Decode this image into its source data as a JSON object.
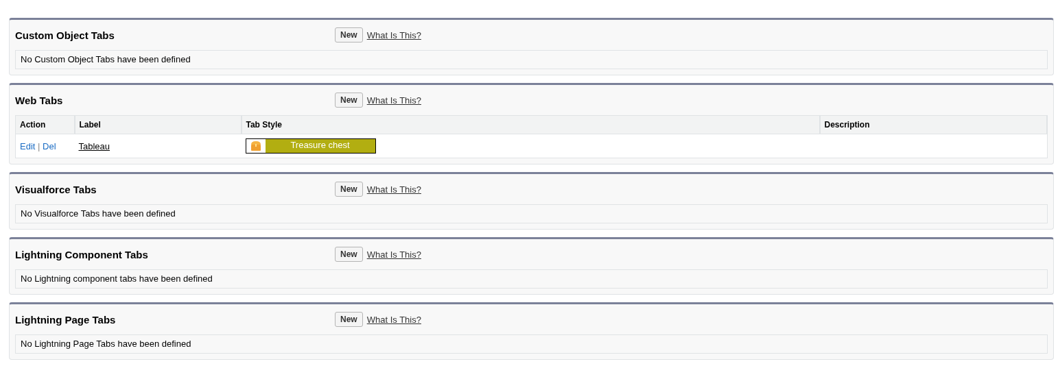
{
  "sections": [
    {
      "title": "Custom Object Tabs",
      "kind": "empty",
      "new_button": "New",
      "help_link": "What Is This?",
      "message": "No Custom Object Tabs have been defined"
    },
    {
      "title": "Web Tabs",
      "kind": "table",
      "new_button": "New",
      "help_link": "What Is This?",
      "columns": [
        "Action",
        "Label",
        "Tab Style",
        "Description"
      ],
      "rows": [
        {
          "edit": "Edit",
          "separator": "|",
          "delete": "Del",
          "label": "Tableau",
          "tab_style": "Treasure chest"
        }
      ]
    },
    {
      "title": "Visualforce Tabs",
      "kind": "empty",
      "new_button": "New",
      "help_link": "What Is This?",
      "message": "No Visualforce Tabs have been defined"
    },
    {
      "title": "Lightning Component Tabs",
      "kind": "empty",
      "new_button": "New",
      "help_link": "What Is This?",
      "message": "No Lightning component tabs have been defined"
    },
    {
      "title": "Lightning Page Tabs",
      "kind": "empty",
      "new_button": "New",
      "help_link": "What Is This?",
      "message": "No Lightning Page Tabs have been defined"
    }
  ]
}
